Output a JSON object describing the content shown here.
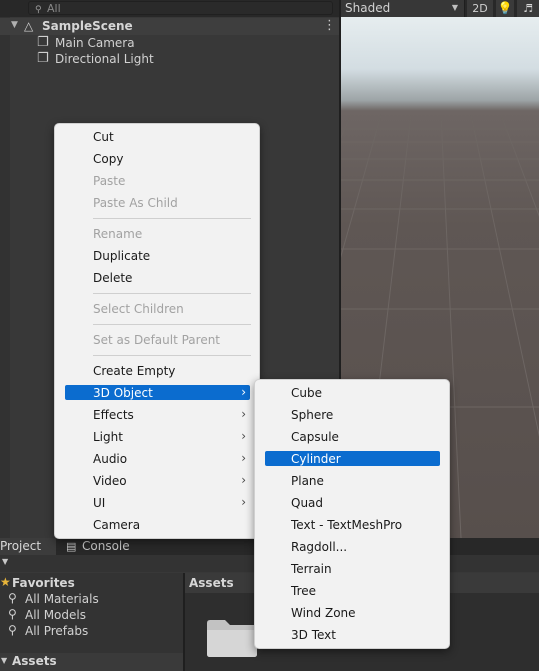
{
  "hierarchy": {
    "search_text": "All",
    "scene_name": "SampleScene",
    "items": [
      {
        "label": "Main Camera",
        "icon": "cube-icon"
      },
      {
        "label": "Directional Light",
        "icon": "cube-icon"
      }
    ]
  },
  "scene_view": {
    "shading_mode": "Shaded",
    "mode_2d": "2D"
  },
  "context_menu": {
    "items": [
      {
        "label": "Cut",
        "enabled": true
      },
      {
        "label": "Copy",
        "enabled": true
      },
      {
        "label": "Paste",
        "enabled": false
      },
      {
        "label": "Paste As Child",
        "enabled": false
      },
      {
        "label": "Rename",
        "enabled": false
      },
      {
        "label": "Duplicate",
        "enabled": true
      },
      {
        "label": "Delete",
        "enabled": true
      },
      {
        "label": "Select Children",
        "enabled": false
      },
      {
        "label": "Set as Default Parent",
        "enabled": false
      },
      {
        "label": "Create Empty",
        "enabled": true
      },
      {
        "label": "3D Object",
        "enabled": true,
        "submenu": true,
        "highlighted": true
      },
      {
        "label": "Effects",
        "enabled": true,
        "submenu": true
      },
      {
        "label": "Light",
        "enabled": true,
        "submenu": true
      },
      {
        "label": "Audio",
        "enabled": true,
        "submenu": true
      },
      {
        "label": "Video",
        "enabled": true,
        "submenu": true
      },
      {
        "label": "UI",
        "enabled": true,
        "submenu": true
      },
      {
        "label": "Camera",
        "enabled": true
      }
    ]
  },
  "submenu_3d_object": {
    "items": [
      {
        "label": "Cube"
      },
      {
        "label": "Sphere"
      },
      {
        "label": "Capsule"
      },
      {
        "label": "Cylinder",
        "highlighted": true
      },
      {
        "label": "Plane"
      },
      {
        "label": "Quad"
      },
      {
        "label": "Text - TextMeshPro"
      },
      {
        "label": "Ragdoll..."
      },
      {
        "label": "Terrain"
      },
      {
        "label": "Tree"
      },
      {
        "label": "Wind Zone"
      },
      {
        "label": "3D Text"
      }
    ]
  },
  "project": {
    "tabs": [
      "Project",
      "Console"
    ],
    "favorites_label": "Favorites",
    "favorites": [
      "All Materials",
      "All Models",
      "All Prefabs"
    ],
    "assets_tree_label": "Assets",
    "assets_header": "Assets"
  },
  "colors": {
    "highlight": "#0b6ccf",
    "panel_bg": "#383838",
    "menu_bg": "#f2f2f2"
  }
}
